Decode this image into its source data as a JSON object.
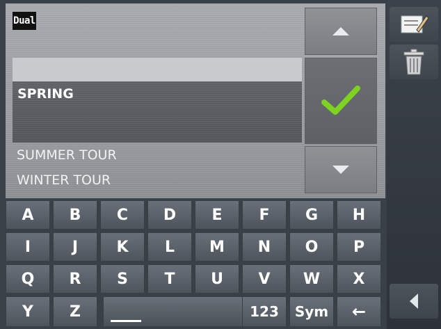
{
  "brand": {
    "logo_text": "Dual"
  },
  "list": {
    "input_value": "",
    "selected": "SPRING",
    "items": [
      "SUMMER TOUR",
      "WINTER TOUR"
    ]
  },
  "sidebar": {
    "edit_icon": "edit-note-icon",
    "trash_icon": "trash-icon",
    "back_icon": "back-arrow-icon"
  },
  "controls": {
    "up_icon": "arrow-up-icon",
    "ok_icon": "checkmark-icon",
    "down_icon": "arrow-down-icon"
  },
  "keyboard": {
    "row1": [
      "A",
      "B",
      "C",
      "D",
      "E",
      "F",
      "G",
      "H"
    ],
    "row2": [
      "I",
      "J",
      "K",
      "L",
      "M",
      "N",
      "O",
      "P"
    ],
    "row3": [
      "Q",
      "R",
      "S",
      "T",
      "U",
      "V",
      "W",
      "X"
    ],
    "row4_left": [
      "Y",
      "Z"
    ],
    "numbers_label": "123",
    "symbols_label": "Sym",
    "backspace_label": "←"
  },
  "colors": {
    "check": "#7ed321",
    "panel": "#9c9fa3",
    "key": "#5b616a"
  }
}
